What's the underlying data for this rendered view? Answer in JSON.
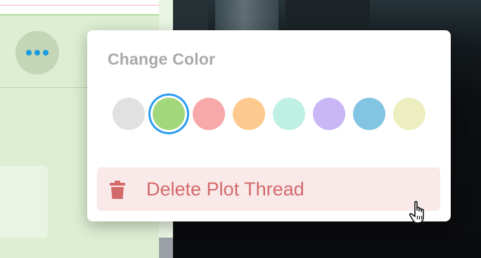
{
  "popup": {
    "title": "Change Color",
    "swatches": [
      {
        "name": "gray",
        "color": "#e1e1e1",
        "selected": false
      },
      {
        "name": "green",
        "color": "#a3d77b",
        "selected": true
      },
      {
        "name": "pink",
        "color": "#f7a8a8",
        "selected": false
      },
      {
        "name": "orange",
        "color": "#fcc98e",
        "selected": false
      },
      {
        "name": "mint",
        "color": "#bff0e4",
        "selected": false
      },
      {
        "name": "lavender",
        "color": "#c9b6f5",
        "selected": false
      },
      {
        "name": "blue",
        "color": "#82c4e2",
        "selected": false
      },
      {
        "name": "yellow",
        "color": "#edeebf",
        "selected": false
      }
    ],
    "selected_ring_color": "#2b9cf0",
    "delete_label": "Delete Plot Thread",
    "delete_icon": "trash-icon"
  },
  "card": {
    "more_icon": "more-horizontal-icon",
    "accent": "#1a9ae0"
  }
}
